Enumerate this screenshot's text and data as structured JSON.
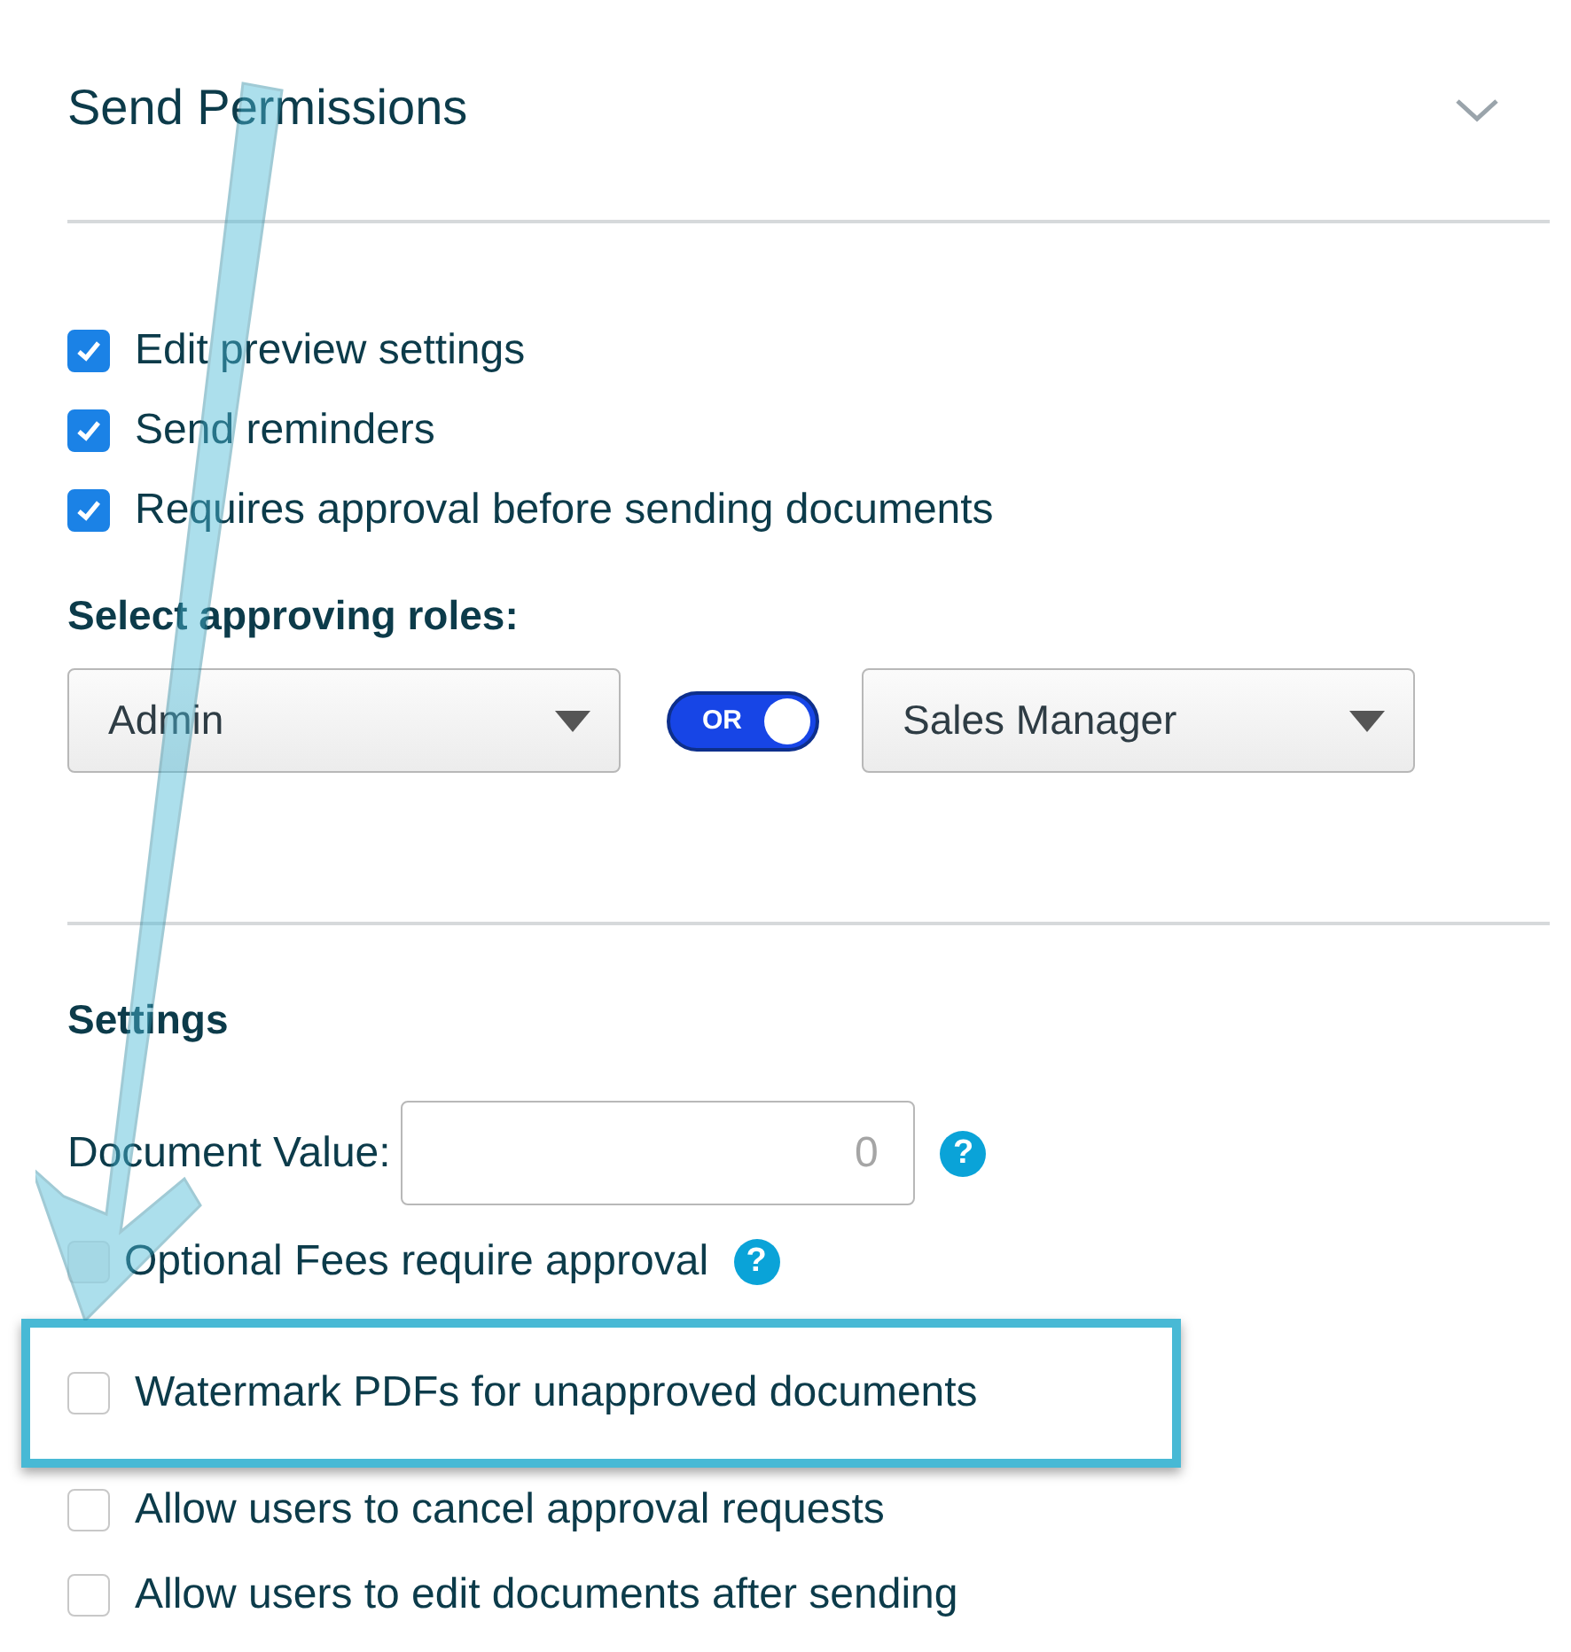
{
  "section": {
    "title": "Send Permissions",
    "expanded": true
  },
  "permissions": [
    {
      "label": "Edit preview settings",
      "checked": true
    },
    {
      "label": "Send reminders",
      "checked": true
    },
    {
      "label": "Requires approval before sending documents",
      "checked": true
    }
  ],
  "roles": {
    "label": "Select approving roles:",
    "first": "Admin",
    "toggle": {
      "label": "OR",
      "on": true
    },
    "second": "Sales Manager"
  },
  "settings": {
    "title": "Settings",
    "document_value": {
      "label": "Document Value:",
      "value": "0",
      "help": "?"
    },
    "options": [
      {
        "label": "Optional Fees require approval",
        "checked": false,
        "disabled": true,
        "help": "?",
        "highlighted": false
      },
      {
        "label": "Watermark PDFs for unapproved documents",
        "checked": false,
        "disabled": false,
        "highlighted": true
      },
      {
        "label": "Allow users to cancel approval requests",
        "checked": false,
        "disabled": false,
        "highlighted": false
      },
      {
        "label": "Allow users to edit documents after sending",
        "checked": false,
        "disabled": false,
        "highlighted": false
      }
    ]
  }
}
